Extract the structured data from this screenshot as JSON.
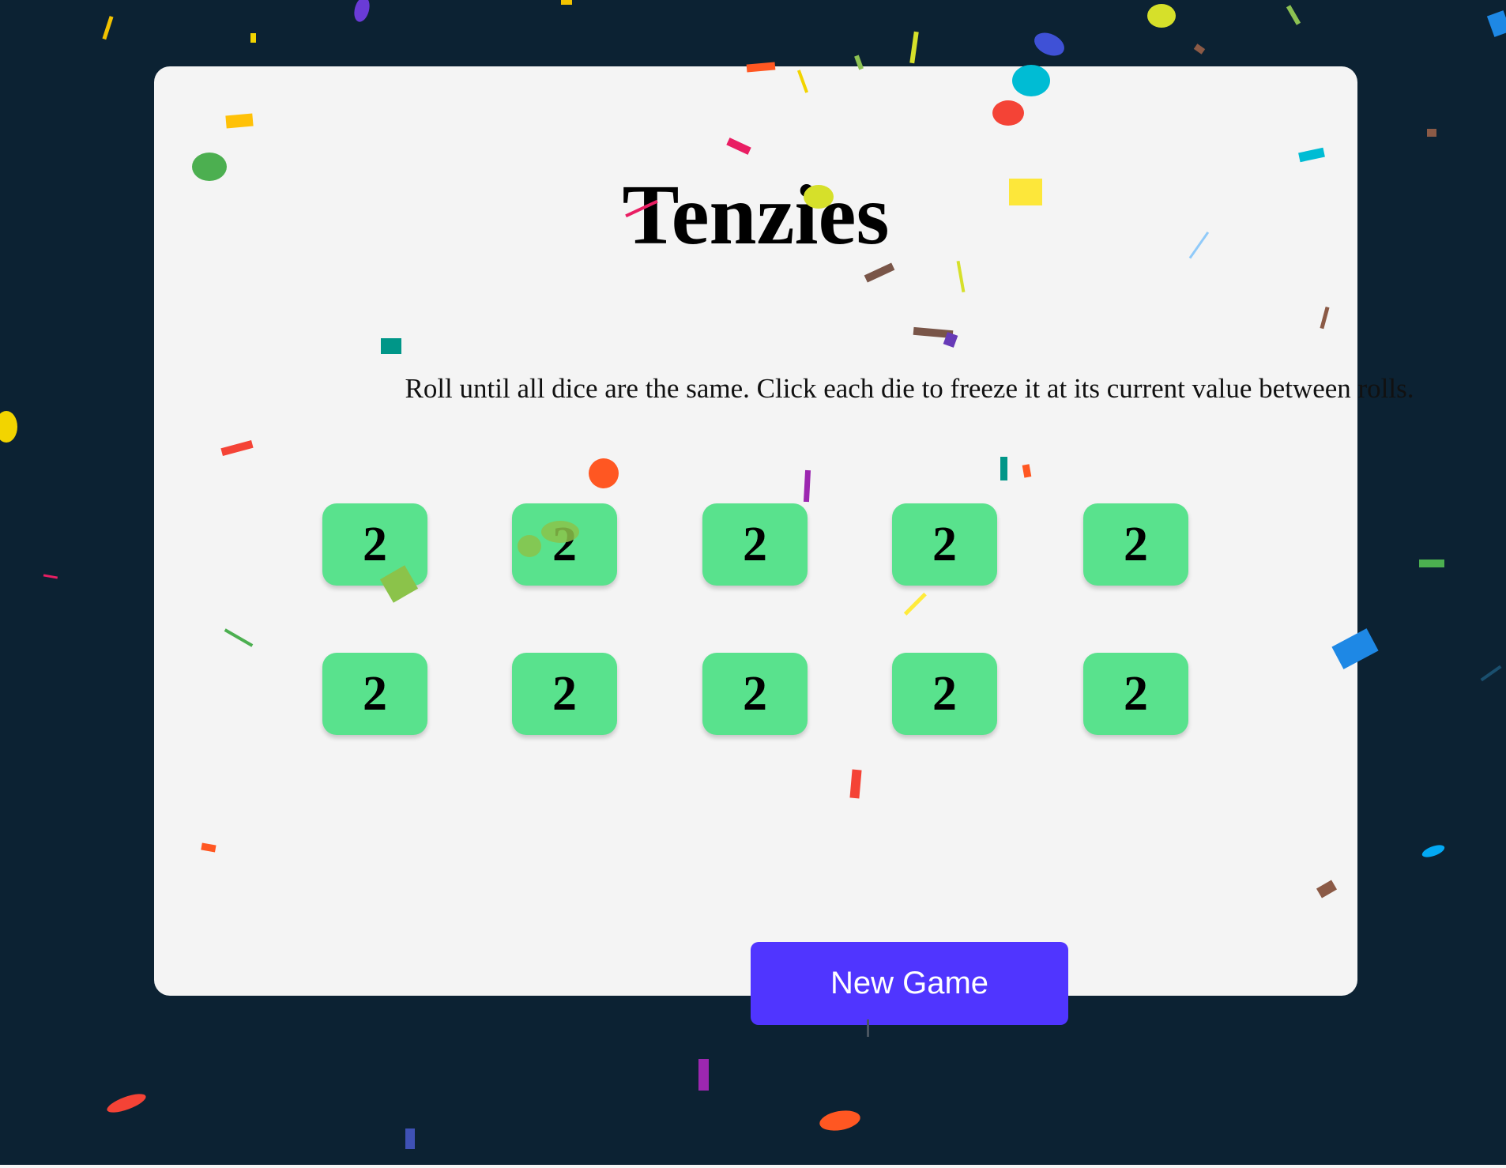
{
  "game": {
    "title": "Tenzies",
    "instructions": "Roll until all dice are the same. Click each die to freeze it at its current value between rolls.",
    "dice": [
      {
        "value": "2"
      },
      {
        "value": "2"
      },
      {
        "value": "2"
      },
      {
        "value": "2"
      },
      {
        "value": "2"
      },
      {
        "value": "2"
      },
      {
        "value": "2"
      },
      {
        "value": "2"
      },
      {
        "value": "2"
      },
      {
        "value": "2"
      }
    ],
    "new_game_label": "New Game"
  },
  "colors": {
    "background": "#0c2233",
    "card": "#f4f4f4",
    "die": "#59e28d",
    "button": "#5035ff"
  }
}
